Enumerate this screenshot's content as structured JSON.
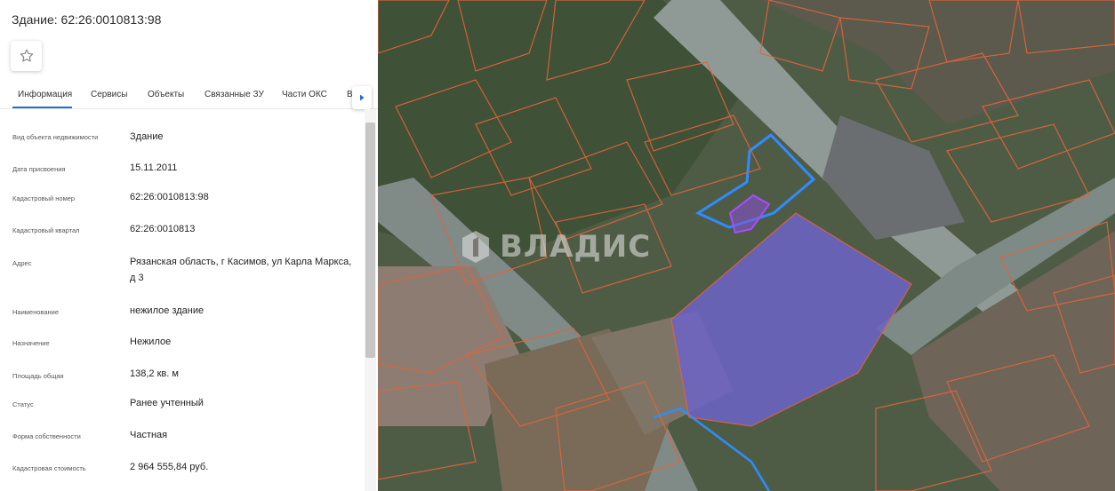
{
  "panel": {
    "title": "Здание: 62:26:0010813:98",
    "favorite_icon": "star-outline-icon",
    "tabs": [
      {
        "label": "Информация",
        "active": true
      },
      {
        "label": "Сервисы",
        "active": false
      },
      {
        "label": "Объекты",
        "active": false
      },
      {
        "label": "Связанные ЗУ",
        "active": false
      },
      {
        "label": "Части ОКС",
        "active": false
      },
      {
        "label": "В",
        "active": false
      }
    ],
    "tab_next_icon": "chevron-right-icon",
    "rows": [
      {
        "label": "Вид объекта недвижимости",
        "value": "Здание"
      },
      {
        "label": "Дата присвоения",
        "value": "15.11.2011"
      },
      {
        "label": "Кадастровый номер",
        "value": "62:26:0010813:98"
      },
      {
        "label": "Кадастровый квартал",
        "value": "62:26:0010813"
      },
      {
        "label": "Адрес",
        "value": "Рязанская область, г Касимов, ул Карла Маркса, д 3"
      },
      {
        "label": "Наименование",
        "value": "нежилое здание"
      },
      {
        "label": "Назначение",
        "value": "Нежилое"
      },
      {
        "label": "Площадь общая",
        "value": "138,2 кв. м"
      },
      {
        "label": "Статус",
        "value": "Ранее учтенный"
      },
      {
        "label": "Форма собственности",
        "value": "Частная"
      },
      {
        "label": "Кадастровая стоимость",
        "value": "2 964 555,84 руб."
      }
    ]
  },
  "map": {
    "watermark_text": "ВЛАДИС",
    "watermark_icon": "vladis-logo-icon",
    "colors": {
      "parcel_border": "#e0643a",
      "selected_border": "#2f8cff",
      "highlight_border": "#a64dff",
      "highlight_fill": "#8a4fd8",
      "large_block_fill": "#6c63c8"
    }
  }
}
